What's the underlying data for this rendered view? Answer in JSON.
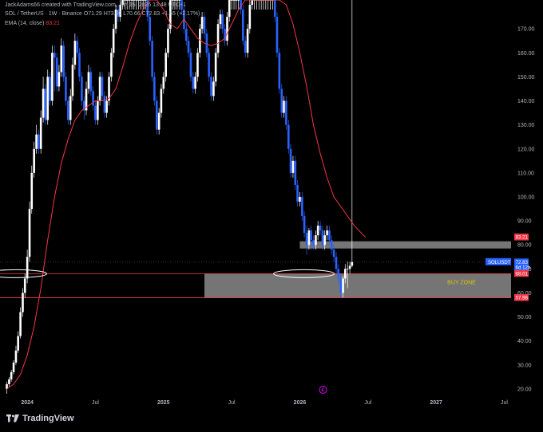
{
  "header": {
    "author_line": "JackAdams66 created with TradingView.com, Jun 15, 2026 13:48 UTC+1",
    "symbol_line": "SOL / TetherUS · 1W · Binance",
    "ohlc": "O71.29 H73.00 L70.66 C72.83 +1.55 (+2.17%)",
    "ema_label": "EMA (14, close)",
    "ema_value": "83.21"
  },
  "footer": {
    "brand": "TradingView"
  },
  "colors": {
    "bull": "#ffffff",
    "bear": "#2962ff",
    "ema": "#f23645",
    "bg": "#000000",
    "zone": "#9b9b9b"
  },
  "chart_data": {
    "type": "candlestick",
    "title": "SOL / TetherUS · 1W · Binance",
    "y_ticks": [
      20,
      30,
      40,
      50,
      60,
      70,
      80,
      90,
      100,
      110,
      120,
      130,
      140,
      150,
      160,
      170
    ],
    "y_tick_labels": [
      "20.00",
      "30.00",
      "40.00",
      "50.00",
      "60.00",
      "70.00",
      "80.00",
      "90.00",
      "100.00",
      "110.00",
      "120.00",
      "130.00",
      "140.00",
      "150.00",
      "160.00",
      "170.00"
    ],
    "ylim": [
      17,
      182
    ],
    "x_tick_labels": [
      "2024",
      "Jul",
      "2025",
      "Jul",
      "2026",
      "Jul",
      "2027",
      "Jul"
    ],
    "x_tick_positions": [
      0.0,
      0.5,
      1.0,
      1.5,
      2.0,
      2.5,
      3.0,
      3.5
    ],
    "xlim": [
      -0.2,
      3.55
    ],
    "series": [
      {
        "name": "SOLUSDT",
        "x": [
          -0.15,
          -0.133,
          -0.117,
          -0.1,
          -0.083,
          -0.067,
          -0.05,
          -0.033,
          -0.017,
          0.0,
          0.017,
          0.033,
          0.05,
          0.067,
          0.083,
          0.1,
          0.117,
          0.133,
          0.15,
          0.167,
          0.183,
          0.2,
          0.217,
          0.233,
          0.25,
          0.267,
          0.283,
          0.3,
          0.317,
          0.333,
          0.35,
          0.367,
          0.383,
          0.4,
          0.417,
          0.433,
          0.45,
          0.467,
          0.483,
          0.5,
          0.517,
          0.533,
          0.55,
          0.567,
          0.583,
          0.6,
          0.617,
          0.633,
          0.65,
          0.667,
          0.683,
          0.7,
          0.717,
          0.733,
          0.75,
          0.767,
          0.783,
          0.8,
          0.817,
          0.833,
          0.85,
          0.867,
          0.883,
          0.9,
          0.917,
          0.933,
          0.95,
          0.967,
          0.983,
          1.0,
          1.017,
          1.033,
          1.05,
          1.067,
          1.083,
          1.1,
          1.117,
          1.133,
          1.15,
          1.167,
          1.183,
          1.2,
          1.217,
          1.233,
          1.25,
          1.267,
          1.283,
          1.3,
          1.317,
          1.333,
          1.35,
          1.367,
          1.383,
          1.4,
          1.417,
          1.433,
          1.45,
          1.467,
          1.483,
          1.5,
          1.517,
          1.533,
          1.55,
          1.567,
          1.583,
          1.6,
          1.617,
          1.633,
          1.65,
          1.667,
          1.683,
          1.7,
          1.717,
          1.733,
          1.75,
          1.767,
          1.783,
          1.8,
          1.817,
          1.833,
          1.85,
          1.867,
          1.883,
          1.9,
          1.917,
          1.933,
          1.95,
          1.967,
          1.983,
          2.0,
          2.017,
          2.033,
          2.05,
          2.067,
          2.083,
          2.1,
          2.117,
          2.133,
          2.15,
          2.167,
          2.183,
          2.2,
          2.217,
          2.233,
          2.25,
          2.267,
          2.283,
          2.3,
          2.317,
          2.333,
          2.35,
          2.367,
          2.383,
          2.4,
          2.417,
          2.433,
          2.45,
          2.467
        ],
        "open": [
          20,
          22,
          24,
          27,
          31,
          36,
          42,
          52,
          60,
          66,
          75,
          95,
          110,
          120,
          126,
          120,
          133,
          145,
          132,
          150,
          140,
          160,
          158,
          146,
          152,
          163,
          150,
          140,
          132,
          142,
          155,
          165,
          160,
          150,
          140,
          136,
          145,
          152,
          144,
          138,
          132,
          140,
          150,
          142,
          135,
          140,
          150,
          160,
          170,
          178,
          175,
          180,
          182,
          182,
          182,
          182,
          182,
          182,
          182,
          182,
          182,
          182,
          182,
          175,
          165,
          150,
          140,
          128,
          135,
          145,
          150,
          160,
          170,
          182,
          182,
          182,
          182,
          182,
          178,
          170,
          165,
          160,
          150,
          145,
          150,
          160,
          170,
          175,
          168,
          160,
          150,
          142,
          148,
          160,
          172,
          176,
          170,
          165,
          175,
          182,
          182,
          182,
          182,
          182,
          178,
          165,
          160,
          170,
          180,
          182,
          182,
          182,
          182,
          182,
          182,
          182,
          182,
          182,
          182,
          175,
          160,
          145,
          135,
          140,
          130,
          120,
          110,
          115,
          105,
          98,
          100,
          92,
          85,
          80,
          86,
          82,
          80,
          84,
          88,
          86,
          80,
          84,
          86,
          82,
          78,
          75,
          70,
          66,
          60,
          66,
          70,
          70,
          71.29
        ],
        "close": [
          22,
          24,
          27,
          31,
          36,
          42,
          52,
          60,
          66,
          75,
          95,
          110,
          120,
          126,
          120,
          133,
          145,
          132,
          150,
          140,
          160,
          158,
          146,
          152,
          163,
          150,
          140,
          132,
          142,
          155,
          165,
          160,
          150,
          140,
          136,
          145,
          152,
          144,
          138,
          132,
          140,
          150,
          142,
          135,
          140,
          150,
          160,
          170,
          178,
          175,
          180,
          182,
          182,
          182,
          182,
          182,
          182,
          182,
          182,
          182,
          182,
          182,
          175,
          165,
          150,
          140,
          128,
          135,
          145,
          150,
          160,
          170,
          182,
          182,
          182,
          182,
          182,
          178,
          170,
          165,
          160,
          150,
          145,
          150,
          160,
          170,
          175,
          168,
          160,
          150,
          142,
          148,
          160,
          172,
          176,
          170,
          165,
          175,
          182,
          182,
          182,
          182,
          182,
          178,
          165,
          160,
          170,
          180,
          182,
          182,
          182,
          182,
          182,
          182,
          182,
          182,
          182,
          182,
          175,
          160,
          145,
          135,
          140,
          130,
          120,
          110,
          115,
          105,
          98,
          100,
          92,
          85,
          80,
          86,
          82,
          80,
          84,
          88,
          86,
          80,
          84,
          86,
          82,
          78,
          75,
          70,
          66,
          60,
          66,
          70,
          70,
          71.29,
          72.83
        ],
        "high": [
          23,
          25,
          28,
          32,
          38,
          44,
          54,
          62,
          68,
          78,
          98,
          113,
          123,
          130,
          128,
          136,
          150,
          147,
          153,
          152,
          163,
          163,
          160,
          155,
          166,
          165,
          152,
          142,
          145,
          158,
          168,
          167,
          162,
          152,
          142,
          148,
          155,
          154,
          146,
          140,
          142,
          152,
          152,
          144,
          142,
          152,
          162,
          172,
          180,
          180,
          182,
          182,
          182,
          182,
          182,
          182,
          182,
          182,
          182,
          182,
          182,
          182,
          182,
          177,
          167,
          152,
          142,
          137,
          147,
          152,
          162,
          172,
          182,
          182,
          182,
          182,
          182,
          182,
          180,
          172,
          167,
          162,
          152,
          152,
          162,
          172,
          177,
          177,
          170,
          162,
          152,
          150,
          162,
          174,
          178,
          178,
          172,
          177,
          182,
          182,
          182,
          182,
          182,
          182,
          180,
          167,
          172,
          182,
          182,
          182,
          182,
          182,
          182,
          182,
          182,
          182,
          182,
          182,
          182,
          177,
          162,
          147,
          142,
          142,
          132,
          122,
          117,
          117,
          107,
          102,
          102,
          94,
          88,
          87,
          88,
          84,
          86,
          90,
          90,
          88,
          86,
          88,
          88,
          84,
          80,
          77,
          72,
          68,
          67,
          72,
          73,
          73.0
        ],
        "low": [
          18,
          21,
          23,
          26,
          30,
          35,
          41,
          50,
          58,
          64,
          73,
          93,
          108,
          118,
          118,
          118,
          131,
          130,
          130,
          138,
          138,
          144,
          144,
          144,
          150,
          148,
          138,
          130,
          130,
          140,
          153,
          158,
          148,
          138,
          132,
          134,
          143,
          142,
          136,
          130,
          130,
          138,
          140,
          133,
          133,
          138,
          148,
          158,
          168,
          173,
          173,
          178,
          178,
          178,
          178,
          178,
          178,
          178,
          178,
          178,
          178,
          178,
          173,
          163,
          148,
          138,
          126,
          126,
          133,
          143,
          148,
          158,
          168,
          178,
          178,
          178,
          178,
          176,
          168,
          163,
          158,
          148,
          143,
          143,
          148,
          158,
          168,
          166,
          158,
          148,
          140,
          140,
          146,
          158,
          170,
          168,
          163,
          163,
          173,
          178,
          178,
          178,
          178,
          176,
          163,
          158,
          158,
          168,
          178,
          178,
          178,
          178,
          178,
          178,
          178,
          178,
          178,
          178,
          173,
          158,
          143,
          133,
          133,
          128,
          118,
          108,
          108,
          103,
          96,
          96,
          90,
          83,
          76,
          78,
          78,
          78,
          78,
          82,
          84,
          78,
          78,
          82,
          80,
          76,
          73,
          68,
          64,
          58,
          58,
          64,
          62,
          68,
          70.66
        ]
      },
      {
        "name": "EMA (14, close)",
        "x": [
          -0.15,
          -0.1,
          -0.05,
          0.0,
          0.05,
          0.1,
          0.15,
          0.2,
          0.25,
          0.3,
          0.35,
          0.4,
          0.45,
          0.5,
          0.55,
          0.6,
          0.65,
          0.7,
          0.75,
          0.8,
          0.85,
          0.9,
          0.95,
          1.0,
          1.05,
          1.1,
          1.15,
          1.2,
          1.25,
          1.3,
          1.35,
          1.4,
          1.45,
          1.5,
          1.55,
          1.6,
          1.65,
          1.7,
          1.75,
          1.8,
          1.85,
          1.9,
          1.95,
          2.0,
          2.05,
          2.1,
          2.15,
          2.2,
          2.25,
          2.3,
          2.35,
          2.4,
          2.45,
          2.483
        ],
        "values": [
          20,
          22,
          26,
          34,
          46,
          62,
          82,
          100,
          114,
          124,
          132,
          136,
          138,
          140,
          140,
          141,
          145,
          154,
          164,
          172,
          178,
          182,
          182,
          178,
          172,
          170,
          174,
          170,
          166,
          164,
          163,
          164,
          166,
          172,
          178,
          182,
          182,
          182,
          182,
          182,
          182,
          180,
          172,
          160,
          146,
          130,
          118,
          108,
          100,
          96,
          92,
          88,
          85,
          83.21
        ]
      }
    ],
    "annotations": {
      "buy_zone": {
        "label": "BUY ZONE",
        "y_top": 68.01,
        "y_bottom": 57.98,
        "x_start": 1.3
      },
      "resistance_box": {
        "y_top": 81.5,
        "y_bottom": 78.5,
        "x_start": 2.0
      },
      "price_labels": [
        {
          "text": "83.21",
          "value": 83.21,
          "color": "#f23645"
        },
        {
          "text": "72.83",
          "value": 72.83,
          "color": "#2962ff"
        },
        {
          "text": "6d 12h",
          "value": 70.6,
          "color": "#2962ff"
        },
        {
          "text": "68.01",
          "value": 68.01,
          "color": "#f23645"
        },
        {
          "text": "57.98",
          "value": 57.98,
          "color": "#f23645"
        }
      ],
      "symbol_tag": "SOLUSDT",
      "lines": [
        {
          "y": 68.01,
          "color": "#f23645"
        },
        {
          "y": 57.98,
          "color": "#f23645"
        }
      ],
      "ellipses": [
        {
          "cx": -0.08,
          "cy": 68.0
        },
        {
          "cx": 2.03,
          "cy": 68.0
        }
      ]
    },
    "grid": false
  }
}
